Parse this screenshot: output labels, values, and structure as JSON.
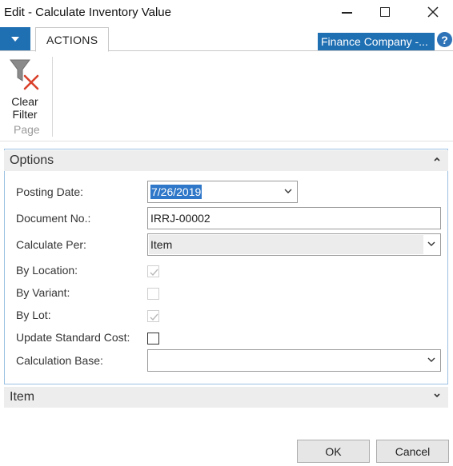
{
  "window": {
    "title": "Edit - Calculate Inventory Value"
  },
  "ribbon": {
    "tab_label": "ACTIONS",
    "company_label": "Finance Company -...",
    "help_glyph": "?",
    "clear_filter_line1": "Clear",
    "clear_filter_line2": "Filter",
    "group_label": "Page"
  },
  "options": {
    "header": "Options",
    "fields": {
      "posting_date_label": "Posting Date:",
      "posting_date_value": "7/26/2019",
      "document_no_label": "Document No.:",
      "document_no_value": "IRRJ-00002",
      "calculate_per_label": "Calculate Per:",
      "calculate_per_value": "Item",
      "by_location_label": "By Location:",
      "by_location_checked": true,
      "by_variant_label": "By Variant:",
      "by_variant_checked": false,
      "by_lot_label": "By Lot:",
      "by_lot_checked": true,
      "update_standard_cost_label": "Update Standard Cost:",
      "update_standard_cost_checked": false,
      "calculation_base_label": "Calculation Base:",
      "calculation_base_value": ""
    }
  },
  "item_tab": {
    "header": "Item"
  },
  "footer": {
    "ok_label": "OK",
    "cancel_label": "Cancel"
  },
  "colors": {
    "accent": "#1f6fb3",
    "panel_border": "#9cc1e3",
    "fasttab_bg": "#ededed",
    "clear_filter_x": "#d9412b"
  },
  "icons": {
    "app_menu": "dropdown-triangle-icon",
    "help": "help-icon",
    "clear_filter": "funnel-clear-icon",
    "collapse": "chevron-up-icon",
    "expand": "chevron-down-icon"
  }
}
